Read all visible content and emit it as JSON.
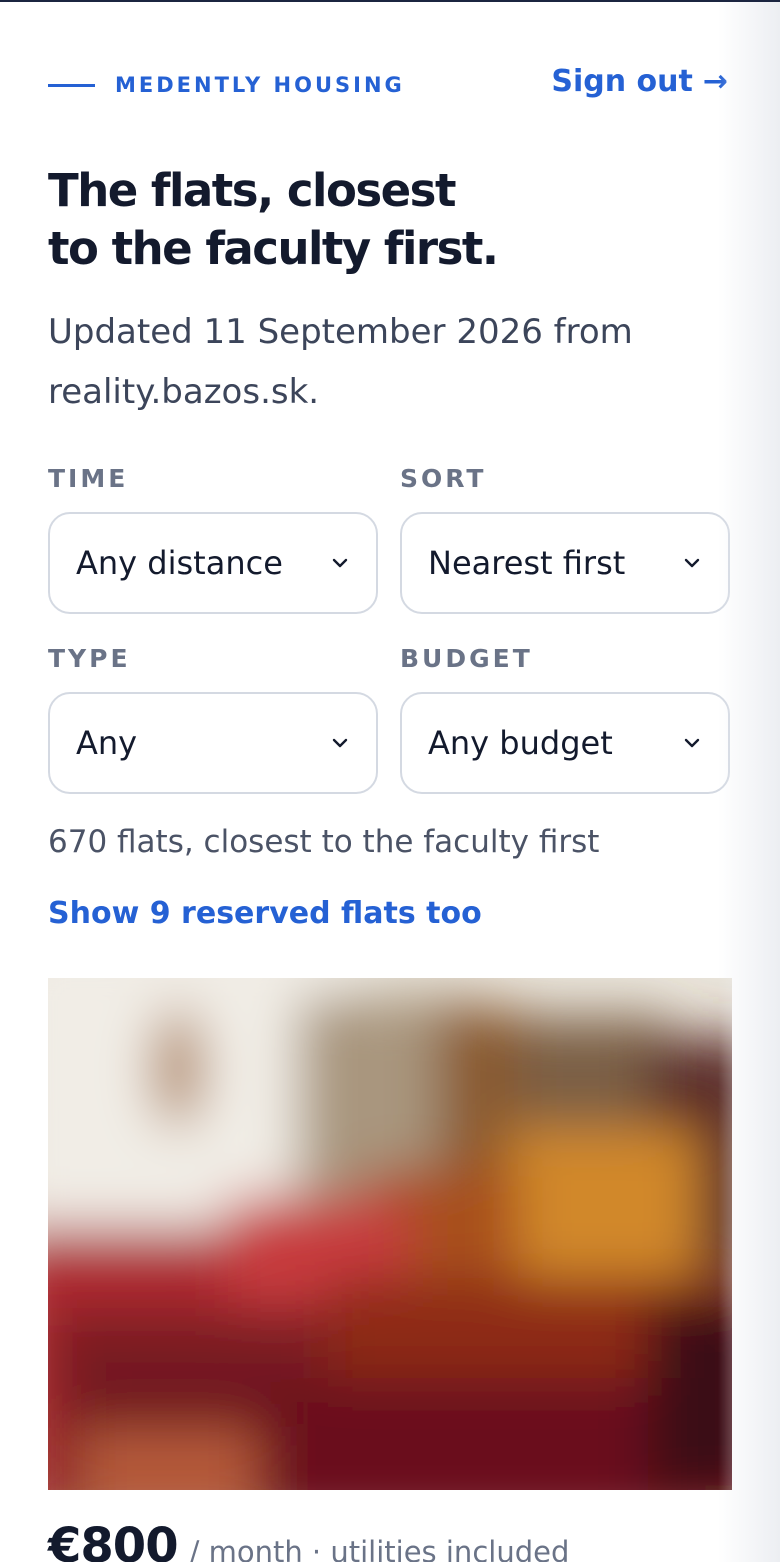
{
  "header": {
    "brand": "MEDENTLY HOUSING",
    "sign_out_label": "Sign out",
    "sign_out_arrow": "→"
  },
  "hero": {
    "title_line1": "The flats, closest",
    "title_line2": "to the faculty first.",
    "subtitle": "Updated 11 September 2026 from reality.bazos.sk."
  },
  "filters": {
    "time": {
      "label": "TIME",
      "value": "Any distance"
    },
    "sort": {
      "label": "SORT",
      "value": "Nearest first"
    },
    "type": {
      "label": "TYPE",
      "value": "Any"
    },
    "budget": {
      "label": "BUDGET",
      "value": "Any budget"
    }
  },
  "results": {
    "count_text": "670 flats, closest to the faculty first",
    "reserved_link": "Show 9 reserved flats too"
  },
  "listing": {
    "price": "€800",
    "price_meta": "/ month · utilities included"
  },
  "colors": {
    "accent": "#2561d4",
    "heading": "#131a2d",
    "muted": "#6a7387",
    "border": "#d4d9e2"
  },
  "icons": {
    "select_chevron": "chevron-down-icon",
    "sign_out_arrow": "arrow-right-icon"
  }
}
